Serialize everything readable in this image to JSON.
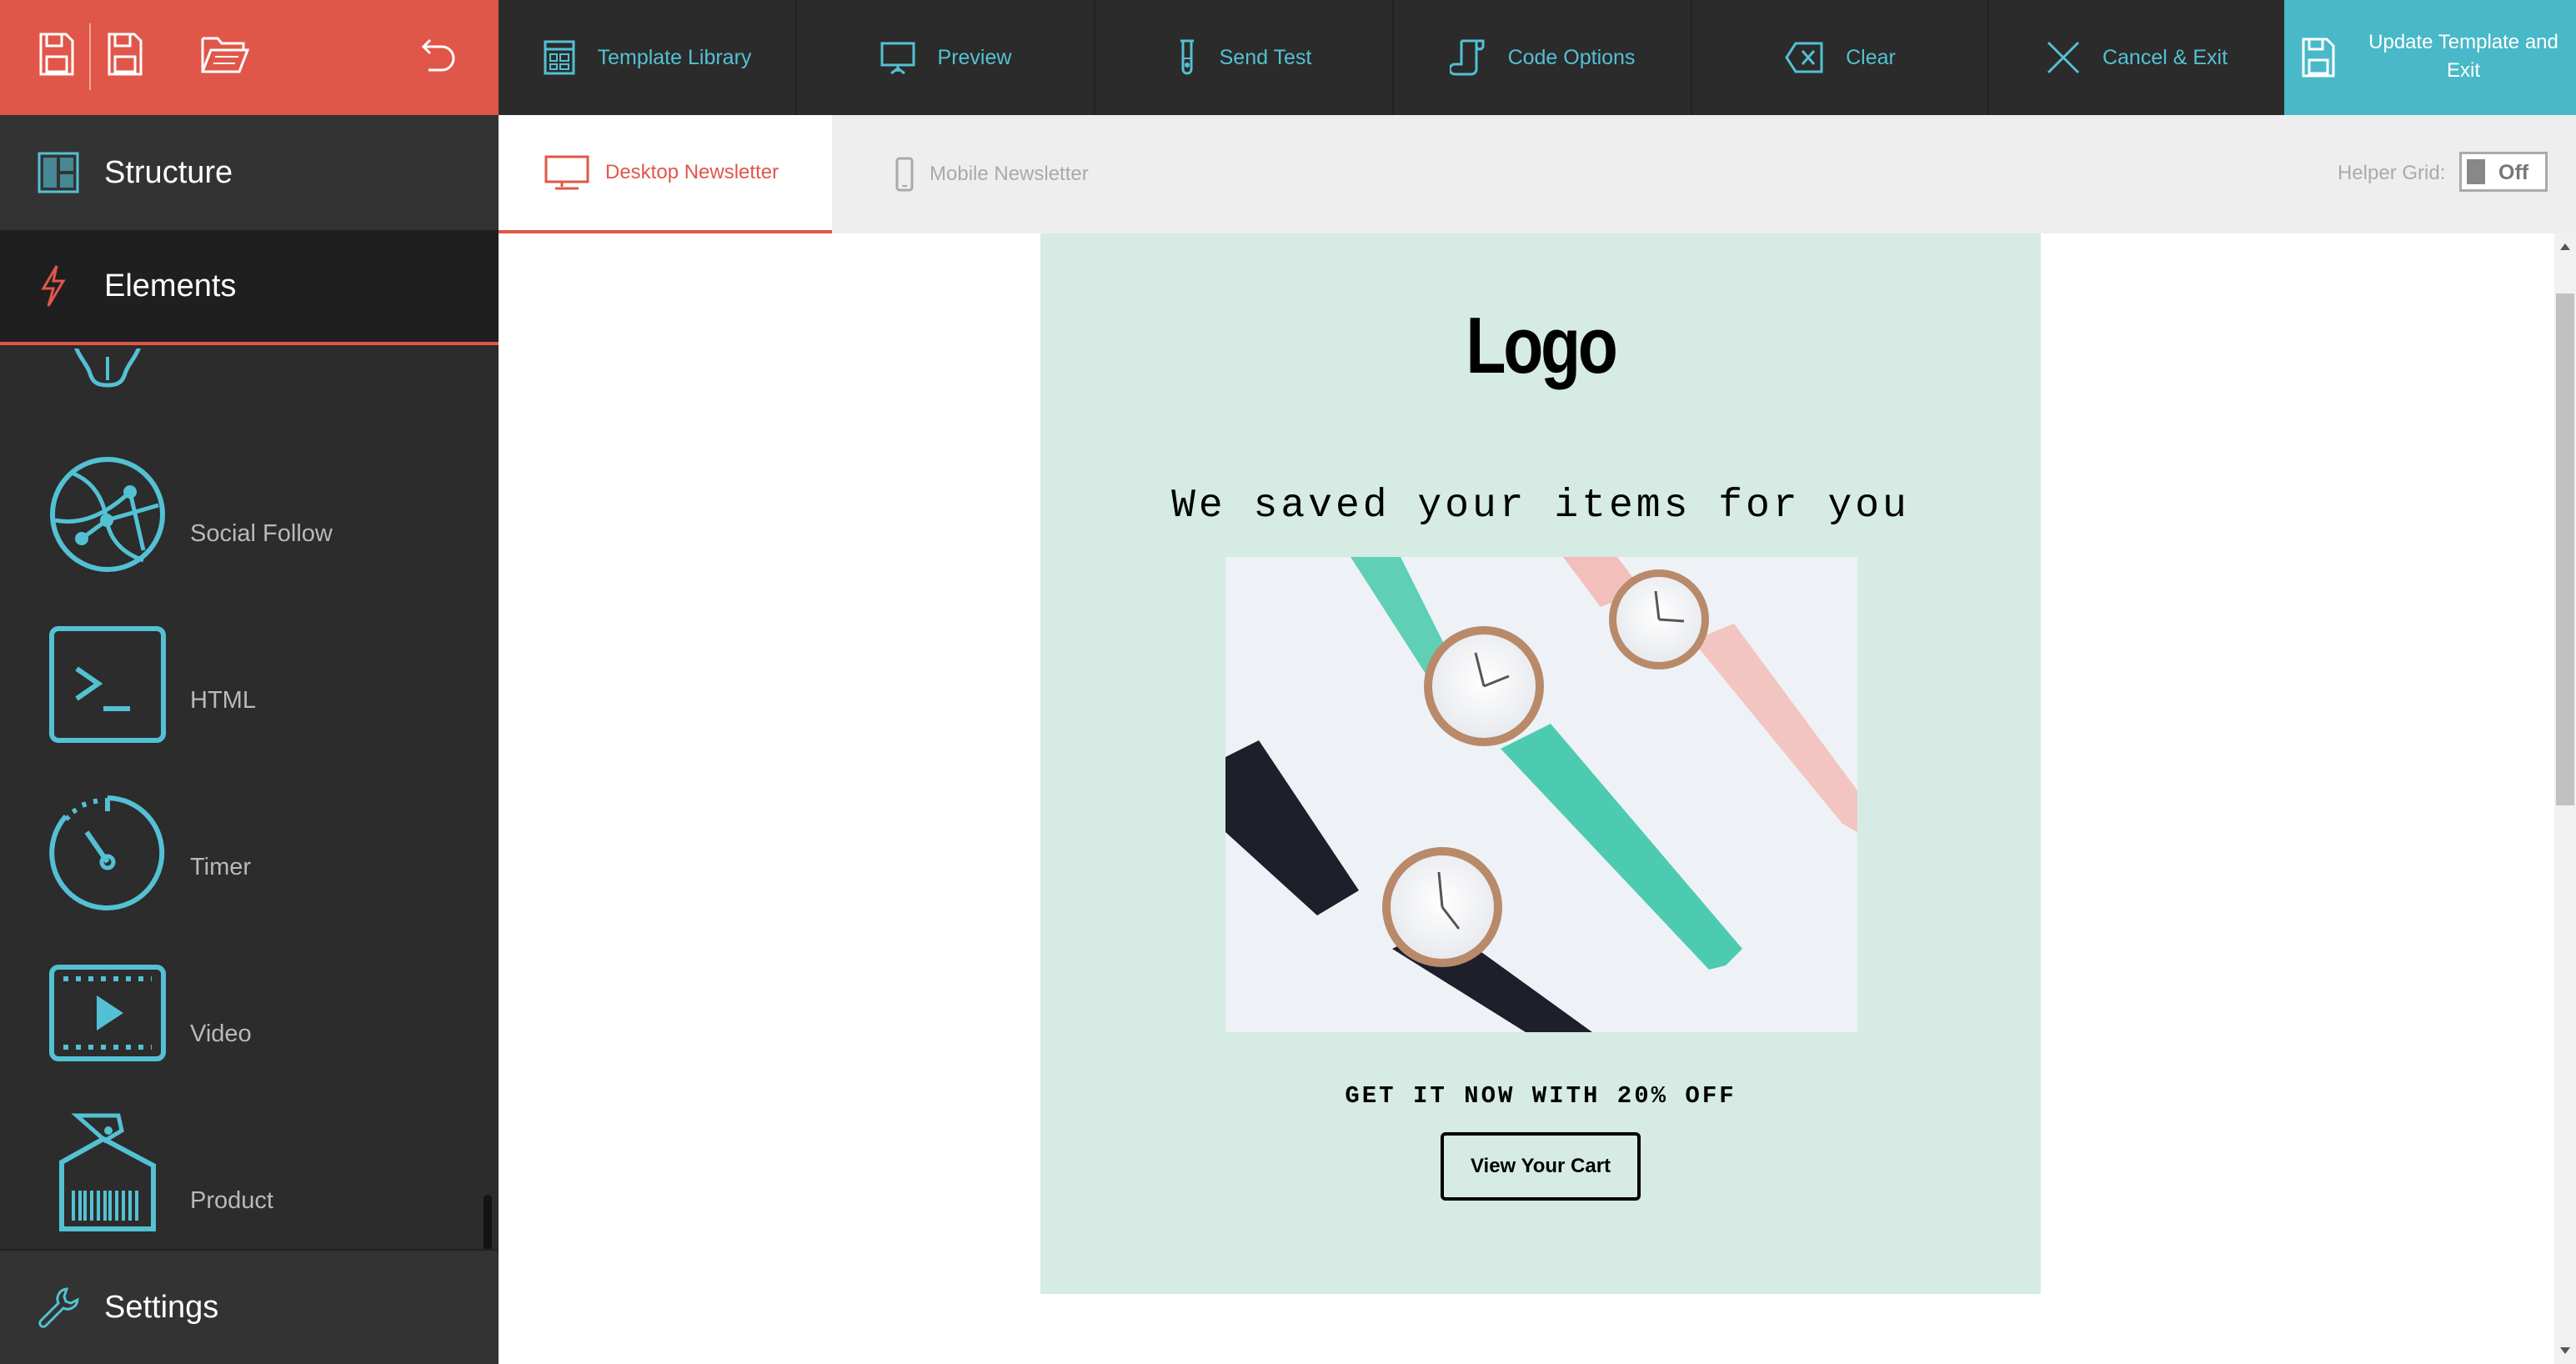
{
  "colors": {
    "accent_red": "#e0574a",
    "accent_teal": "#53c1d3",
    "update_bg": "#49b8c9",
    "dark_bg": "#2b2b2b",
    "newsletter_bg": "#d5ebe4"
  },
  "quick_actions": [
    {
      "icon": "save-icon"
    },
    {
      "icon": "save-as-icon"
    },
    {
      "icon": "open-folder-icon"
    },
    {
      "icon": "undo-icon"
    }
  ],
  "toolbar": {
    "template_library": "Template Library",
    "preview": "Preview",
    "send_test": "Send Test",
    "code_options": "Code Options",
    "clear": "Clear",
    "cancel_exit": "Cancel & Exit",
    "update_line1": "Update Template and",
    "update_line2": "Exit"
  },
  "sidebar": {
    "structure": "Structure",
    "elements": "Elements",
    "settings": "Settings",
    "items": [
      {
        "label": "Social Follow",
        "icon": "globe-network-icon"
      },
      {
        "label": "HTML",
        "icon": "terminal-icon"
      },
      {
        "label": "Timer",
        "icon": "timer-icon"
      },
      {
        "label": "Video",
        "icon": "video-icon"
      },
      {
        "label": "Product",
        "icon": "product-tag-icon"
      }
    ]
  },
  "tabs": {
    "desktop": "Desktop Newsletter",
    "mobile": "Mobile Newsletter",
    "helper_grid_label": "Helper Grid:",
    "helper_grid_value": "Off"
  },
  "newsletter": {
    "logo": "Logo",
    "headline": "We saved your items for you",
    "offer": "GET IT NOW WITH 20% OFF",
    "cta": "View Your Cart"
  }
}
